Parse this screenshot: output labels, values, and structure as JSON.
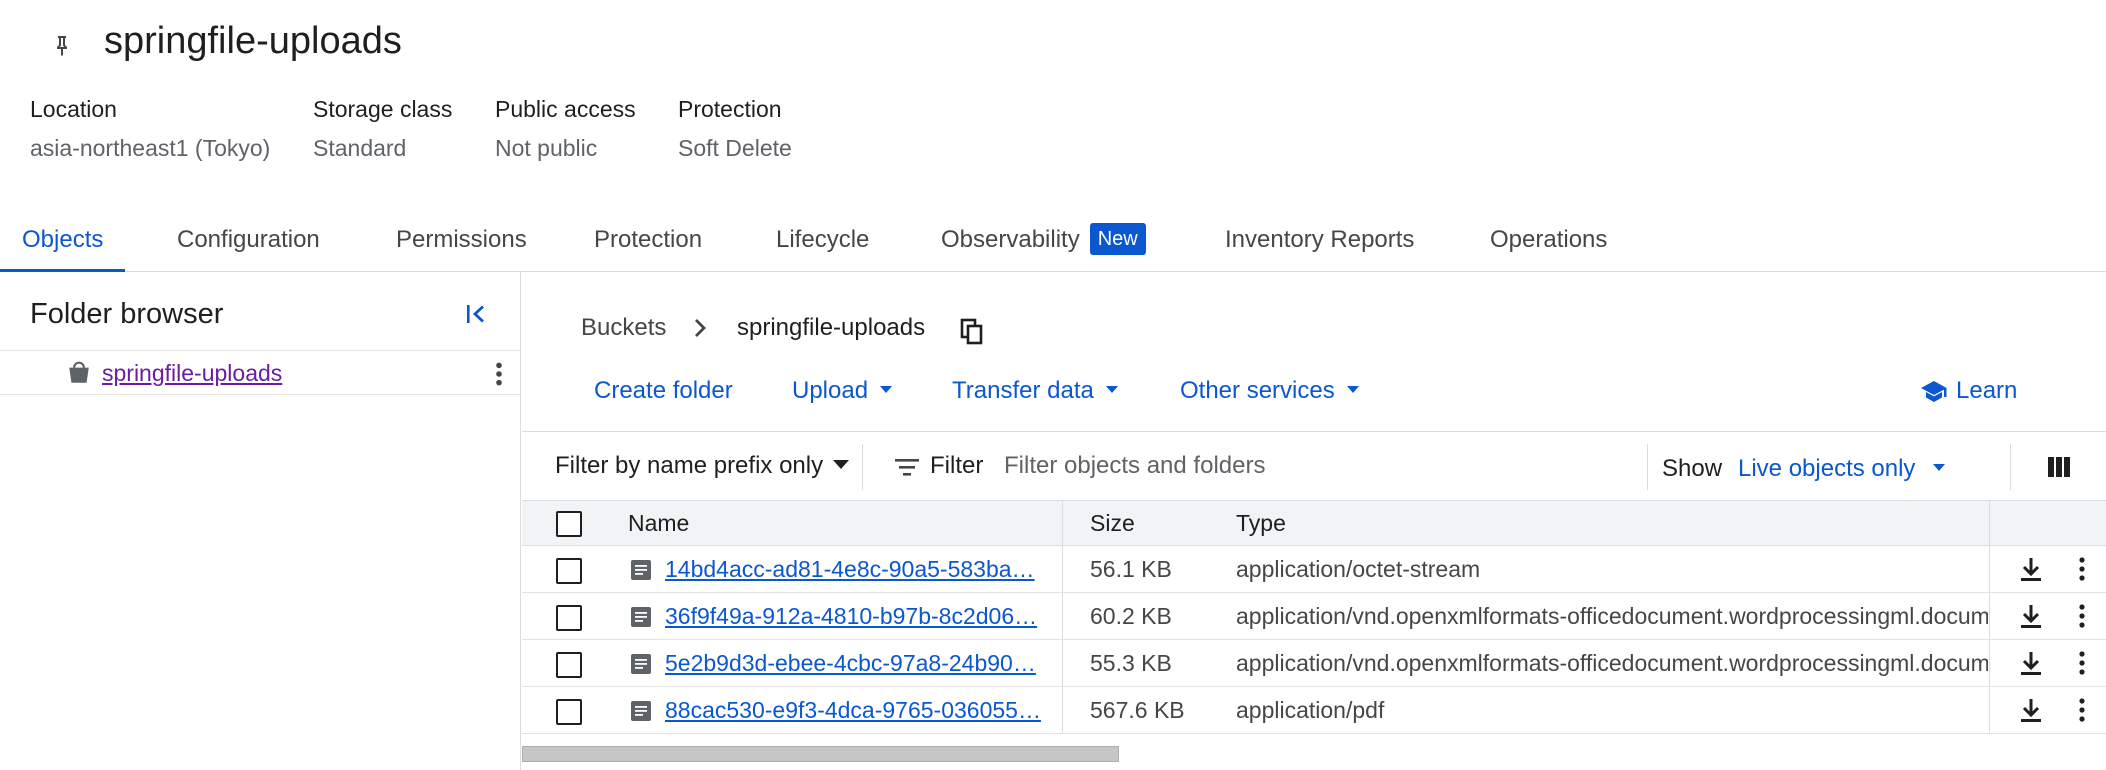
{
  "header": {
    "title": "springfile-uploads",
    "pin_icon": "pin-icon",
    "meta": [
      {
        "label": "Location",
        "value": "asia-northeast1 (Tokyo)"
      },
      {
        "label": "Storage class",
        "value": "Standard"
      },
      {
        "label": "Public access",
        "value": "Not public"
      },
      {
        "label": "Protection",
        "value": "Soft Delete"
      }
    ]
  },
  "tabs": [
    {
      "label": "Objects",
      "active": true
    },
    {
      "label": "Configuration"
    },
    {
      "label": "Permissions"
    },
    {
      "label": "Protection"
    },
    {
      "label": "Lifecycle"
    },
    {
      "label": "Observability",
      "badge": "New"
    },
    {
      "label": "Inventory Reports"
    },
    {
      "label": "Operations"
    }
  ],
  "folder_browser": {
    "title": "Folder browser",
    "collapse_icon": "collapse-left-icon",
    "bucket_icon": "bucket-icon",
    "root_item": "springfile-uploads",
    "more_icon": "more-vert-icon"
  },
  "breadcrumb": {
    "root": "Buckets",
    "current": "springfile-uploads",
    "copy_icon": "copy-icon"
  },
  "actions": {
    "create_folder": "Create folder",
    "upload": "Upload",
    "transfer_data": "Transfer data",
    "other_services": "Other services",
    "learn": "Learn",
    "learn_icon": "school-icon"
  },
  "filter_bar": {
    "mode": "Filter by name prefix only",
    "filter_label": "Filter",
    "placeholder": "Filter objects and folders",
    "show_label": "Show",
    "show_value": "Live objects only",
    "columns_icon": "view-columns-icon"
  },
  "table": {
    "columns": [
      "Name",
      "Size",
      "Type"
    ],
    "rows": [
      {
        "name": "14bd4acc-ad81-4e8c-90a5-583ba…",
        "size": "56.1 KB",
        "type": "application/octet-stream"
      },
      {
        "name": "36f9f49a-912a-4810-b97b-8c2d06…",
        "size": "60.2 KB",
        "type": "application/vnd.openxmlformats-officedocument.wordprocessingml.document"
      },
      {
        "name": "5e2b9d3d-ebee-4cbc-97a8-24b90…",
        "size": "55.3 KB",
        "type": "application/vnd.openxmlformats-officedocument.wordprocessingml.document"
      },
      {
        "name": "88cac530-e9f3-4dca-9765-036055…",
        "size": "567.6 KB",
        "type": "application/pdf"
      }
    ]
  },
  "colors": {
    "accent": "#0b57d0",
    "visited_link": "#681da8",
    "text_primary": "#1f1f1f",
    "text_secondary": "#444746",
    "header_bg": "#f1f3f4",
    "divider": "#dadce0"
  }
}
